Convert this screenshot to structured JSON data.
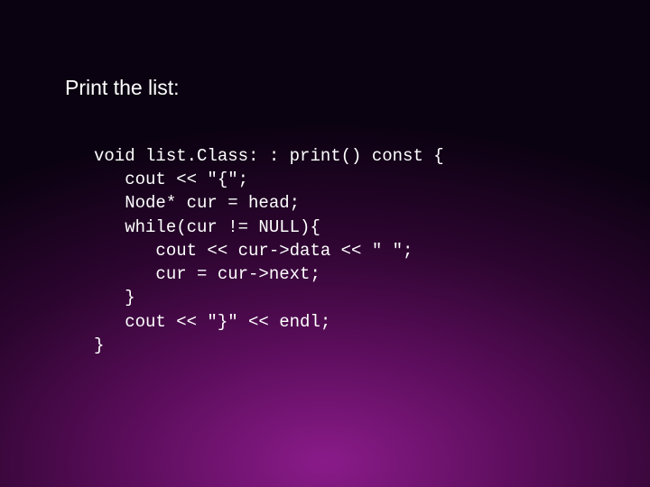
{
  "slide": {
    "heading": "Print the list:",
    "code": "void list.Class: : print() const {\n   cout << \"{\";\n   Node* cur = head;\n   while(cur != NULL){\n      cout << cur->data << \" \";\n      cur = cur->next;\n   }\n   cout << \"}\" << endl;\n}"
  }
}
